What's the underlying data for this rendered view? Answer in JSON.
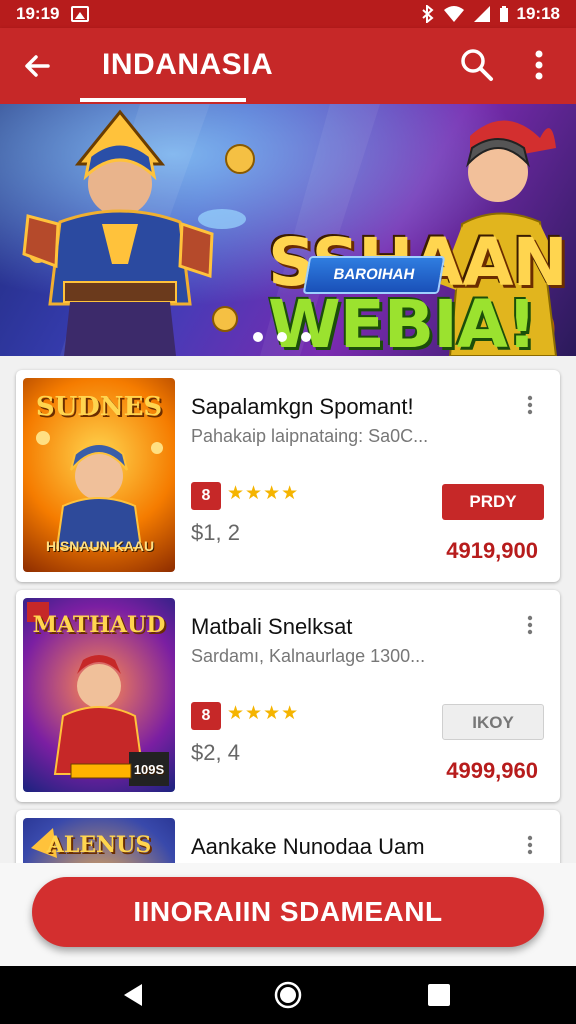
{
  "status_bar": {
    "time_left": "19:19",
    "time_right": "19:18"
  },
  "app_bar": {
    "title": "INDANASIA",
    "back_icon": "arrow-back-icon",
    "search_icon": "search-icon",
    "more_icon": "more-vert-icon"
  },
  "banner": {
    "title_line1": "SSHAAN",
    "title_line2": "WEBIA!",
    "button_label": "BAROIHAH",
    "page_count": 3
  },
  "items": [
    {
      "thumb_title": "SUDNES",
      "thumb_foot": "HISNAUN KAAU",
      "name": "Sapalamkgn Spomant!",
      "desc": "Pahakaip laipnataing: Sa0C...",
      "rating": "8",
      "stars": "★★★★",
      "small_value": "$1, 2",
      "button_label": "PRDY",
      "button_style": "primary",
      "price": "4919,900"
    },
    {
      "thumb_title": "MATHAUD",
      "thumb_foot": "109S",
      "name": "Matbali Snelksat",
      "desc": "Sardamı, Kalnaurlage 1300...",
      "rating": "8",
      "stars": "★★★★",
      "small_value": "$2, 4",
      "button_label": "IKOY",
      "button_style": "secondary",
      "price": "4999,960"
    },
    {
      "thumb_title": "ALENUS",
      "thumb_foot": "",
      "name": "Aankake Nunodaa Uam",
      "desc": "",
      "rating": "",
      "stars": "",
      "small_value": "",
      "button_label": "",
      "button_style": "",
      "price": ""
    }
  ],
  "cta": {
    "label": "IINORAIIN SDAMEANL"
  },
  "colors": {
    "primary": "#c62828",
    "dark": "#b71c1c",
    "star": "#f5b400"
  }
}
